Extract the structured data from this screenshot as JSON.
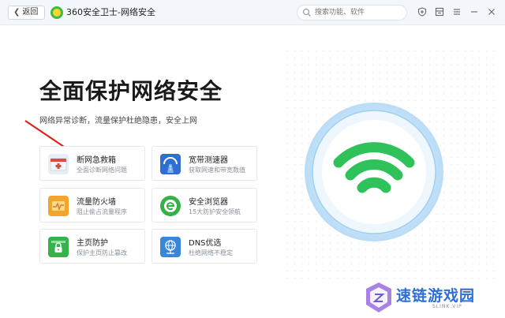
{
  "titlebar": {
    "back_label": "返回",
    "app_title": "360安全卫士-网络安全",
    "search_placeholder": "搜索功能、软件",
    "icons": [
      "shield-icon",
      "skin-icon",
      "menu-icon",
      "minimize-icon",
      "close-icon"
    ]
  },
  "hero": {
    "title": "全面保护网络安全",
    "subtitle": "网络异常诊断，流量保护杜绝隐患，安全上网"
  },
  "cards": [
    {
      "title": "断网急救箱",
      "desc": "全面诊断网络问题",
      "icon": "first-aid-kit-icon",
      "color": "#e9eef5"
    },
    {
      "title": "宽带测速器",
      "desc": "获取网速和带宽数值",
      "icon": "speed-road-icon",
      "color": "#2f6fd0"
    },
    {
      "title": "流量防火墙",
      "desc": "阻止偷占流量程序",
      "icon": "firewall-icon",
      "color": "#f3a42d"
    },
    {
      "title": "安全浏览器",
      "desc": "15大防护安全领航",
      "icon": "browser-e-icon",
      "color": "#38b04a"
    },
    {
      "title": "主页防护",
      "desc": "保护主页防止篡改",
      "icon": "lock-home-icon",
      "color": "#36b24a"
    },
    {
      "title": "DNS优选",
      "desc": "杜绝网络不稳定",
      "icon": "globe-icon",
      "color": "#3a86d8"
    }
  ],
  "badge": {
    "icon": "wifi-icon",
    "accent": "#2fc25b"
  },
  "watermark": {
    "text": "速链游戏园",
    "sub": "SLINK.VIP"
  }
}
